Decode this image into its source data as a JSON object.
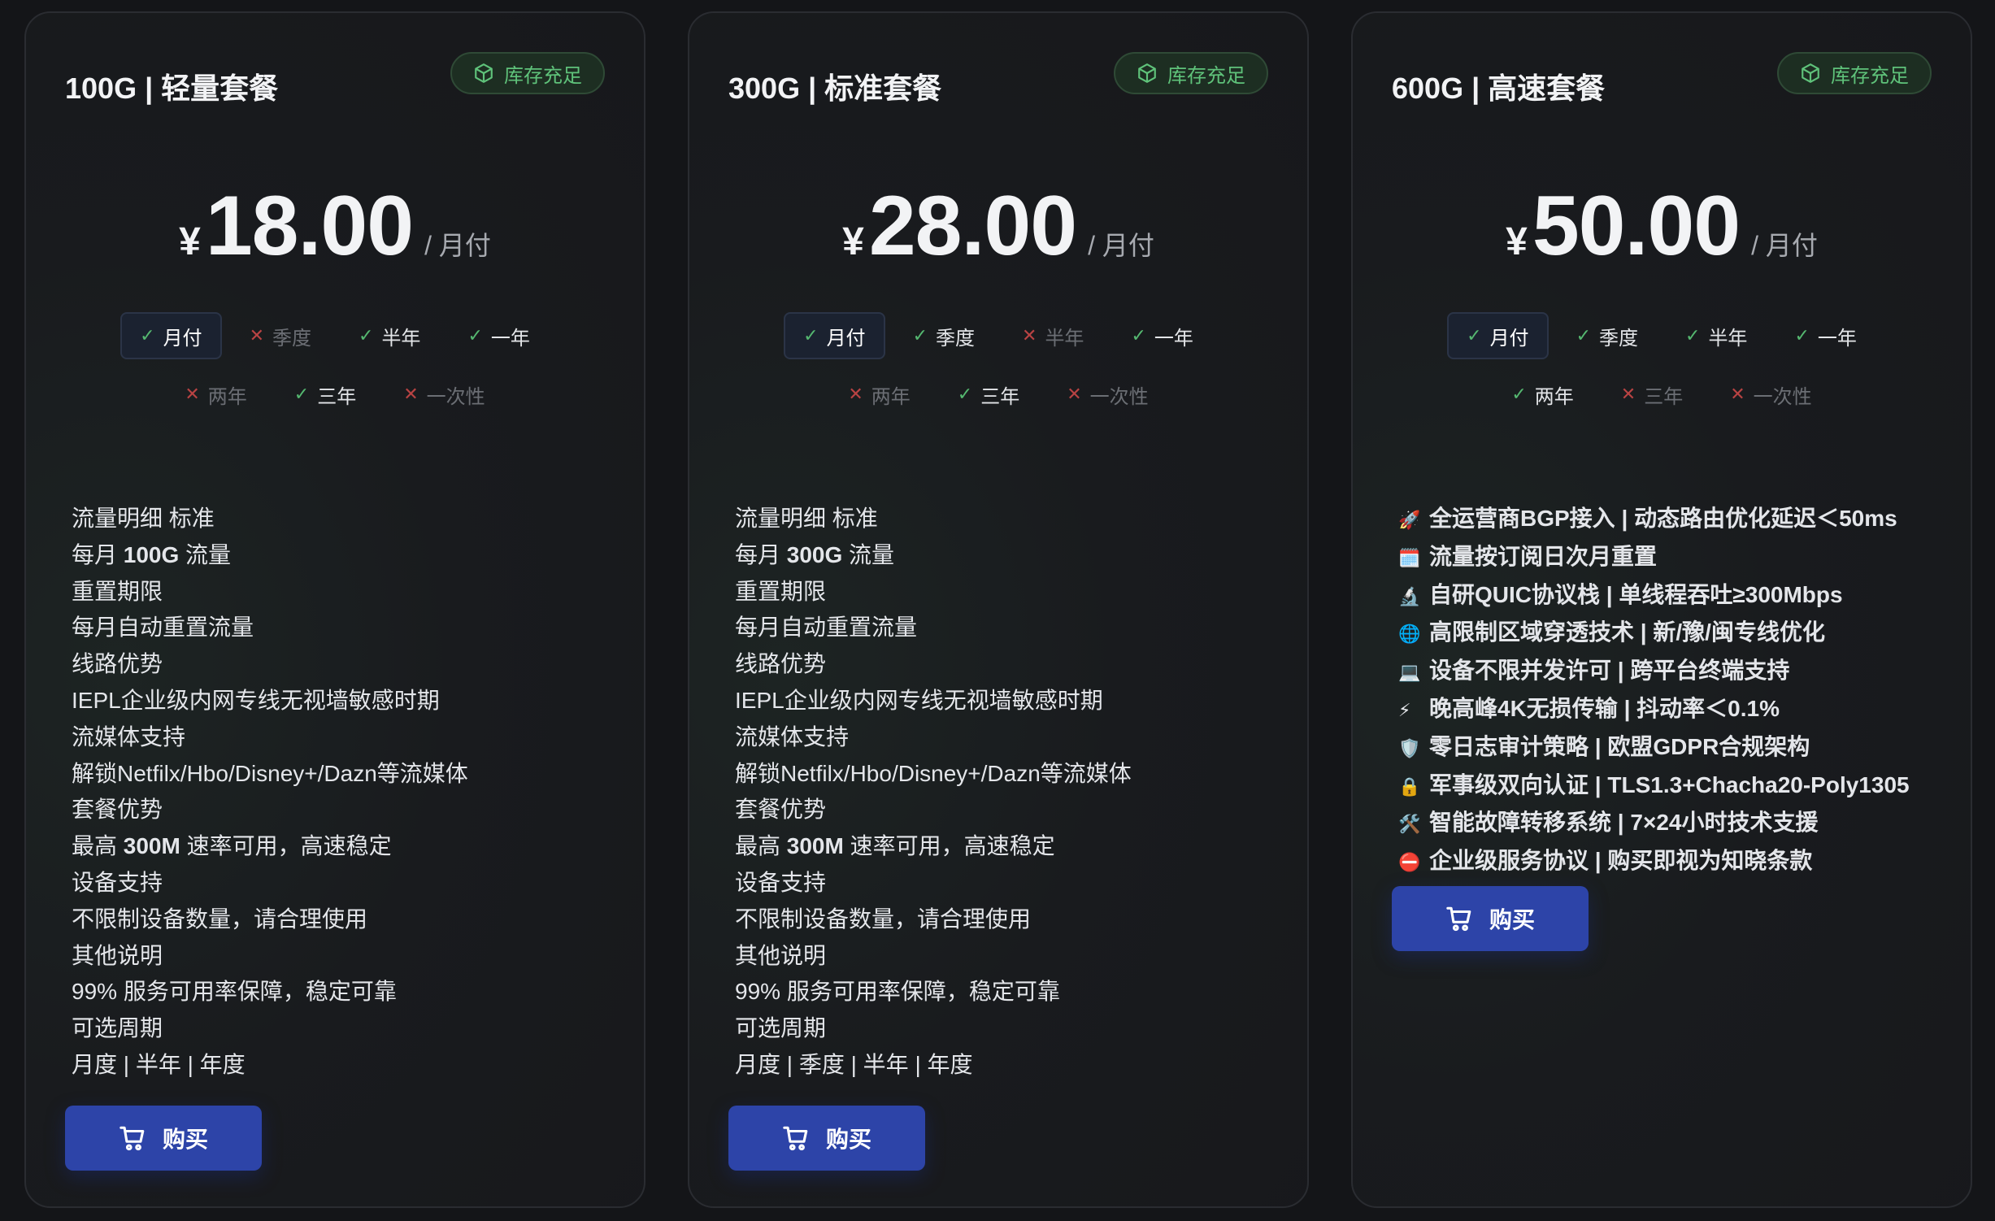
{
  "cards": [
    {
      "title": "100G | 轻量套餐",
      "stock": "库存充足",
      "currency": "¥",
      "price": "18.00",
      "unit": "/ 月付",
      "periods": [
        {
          "label": "月付",
          "available": true,
          "active": true
        },
        {
          "label": "季度",
          "available": false,
          "active": false
        },
        {
          "label": "半年",
          "available": true,
          "active": false
        },
        {
          "label": "一年",
          "available": true,
          "active": false
        },
        {
          "label": "两年",
          "available": false,
          "active": false
        },
        {
          "label": "三年",
          "available": true,
          "active": false
        },
        {
          "label": "一次性",
          "available": false,
          "active": false
        }
      ],
      "features": [
        [
          "流量明细 标准"
        ],
        [
          "每月 ",
          "100G",
          " 流量"
        ],
        [
          "重置期限"
        ],
        [
          "每月自动重置流量"
        ],
        [
          "线路优势"
        ],
        [
          "IEPL企业级内网专线无视墙敏感时期"
        ],
        [
          "流媒体支持"
        ],
        [
          "解锁Netfilx/Hbo/Disney+/Dazn等流媒体"
        ],
        [
          "套餐优势"
        ],
        [
          "最高 ",
          "300M",
          " 速率可用，高速稳定"
        ],
        [
          "设备支持"
        ],
        [
          "不限制设备数量，请合理使用"
        ],
        [
          "其他说明"
        ],
        [
          "99% 服务可用率保障，稳定可靠"
        ],
        [
          "可选周期"
        ],
        [
          "月度 | 半年 | 年度"
        ]
      ],
      "buy_label": "购买"
    },
    {
      "title": "300G | 标准套餐",
      "stock": "库存充足",
      "currency": "¥",
      "price": "28.00",
      "unit": "/ 月付",
      "periods": [
        {
          "label": "月付",
          "available": true,
          "active": true
        },
        {
          "label": "季度",
          "available": true,
          "active": false
        },
        {
          "label": "半年",
          "available": false,
          "active": false
        },
        {
          "label": "一年",
          "available": true,
          "active": false
        },
        {
          "label": "两年",
          "available": false,
          "active": false
        },
        {
          "label": "三年",
          "available": true,
          "active": false
        },
        {
          "label": "一次性",
          "available": false,
          "active": false
        }
      ],
      "features": [
        [
          "流量明细 标准"
        ],
        [
          "每月 ",
          "300G",
          " 流量"
        ],
        [
          "重置期限"
        ],
        [
          "每月自动重置流量"
        ],
        [
          "线路优势"
        ],
        [
          "IEPL企业级内网专线无视墙敏感时期"
        ],
        [
          "流媒体支持"
        ],
        [
          "解锁Netfilx/Hbo/Disney+/Dazn等流媒体"
        ],
        [
          "套餐优势"
        ],
        [
          "最高 ",
          "300M",
          " 速率可用，高速稳定"
        ],
        [
          "设备支持"
        ],
        [
          "不限制设备数量，请合理使用"
        ],
        [
          "其他说明"
        ],
        [
          "99% 服务可用率保障，稳定可靠"
        ],
        [
          "可选周期"
        ],
        [
          "月度 | 季度 | 半年 | 年度"
        ]
      ],
      "buy_label": "购买"
    },
    {
      "title": "600G | 高速套餐",
      "stock": "库存充足",
      "currency": "¥",
      "price": "50.00",
      "unit": "/ 月付",
      "periods": [
        {
          "label": "月付",
          "available": true,
          "active": true
        },
        {
          "label": "季度",
          "available": true,
          "active": false
        },
        {
          "label": "半年",
          "available": true,
          "active": false
        },
        {
          "label": "一年",
          "available": true,
          "active": false
        },
        {
          "label": "两年",
          "available": true,
          "active": false
        },
        {
          "label": "三年",
          "available": false,
          "active": false
        },
        {
          "label": "一次性",
          "available": false,
          "active": false
        }
      ],
      "features": [
        [
          "🚀",
          "全运营商BGP接入 | 动态路由优化延迟＜50ms"
        ],
        [
          "🗓️",
          "流量按订阅日次月重置"
        ],
        [
          "🔬",
          "自研QUIC协议栈 | 单线程吞吐≥300Mbps"
        ],
        [
          "🌐",
          "高限制区域穿透技术 | 新/豫/闽专线优化"
        ],
        [
          "💻",
          "设备不限并发许可 | 跨平台终端支持"
        ],
        [
          "⚡",
          "晚高峰4K无损传输 | 抖动率＜0.1%"
        ],
        [
          "🛡️",
          "零日志审计策略 | 欧盟GDPR合规架构"
        ],
        [
          "🔒",
          "军事级双向认证 | TLS1.3+Chacha20-Poly1305"
        ],
        [
          "🛠️",
          "智能故障转移系统 | 7×24小时技术支援"
        ],
        [
          "⛔",
          "企业级服务协议 | 购买即视为知晓条款"
        ]
      ],
      "buy_label": "购买"
    }
  ],
  "colors": {
    "accent": "#2d44a8",
    "ok": "#55b870",
    "no": "#b94343",
    "badge_text": "#5fc27a"
  }
}
